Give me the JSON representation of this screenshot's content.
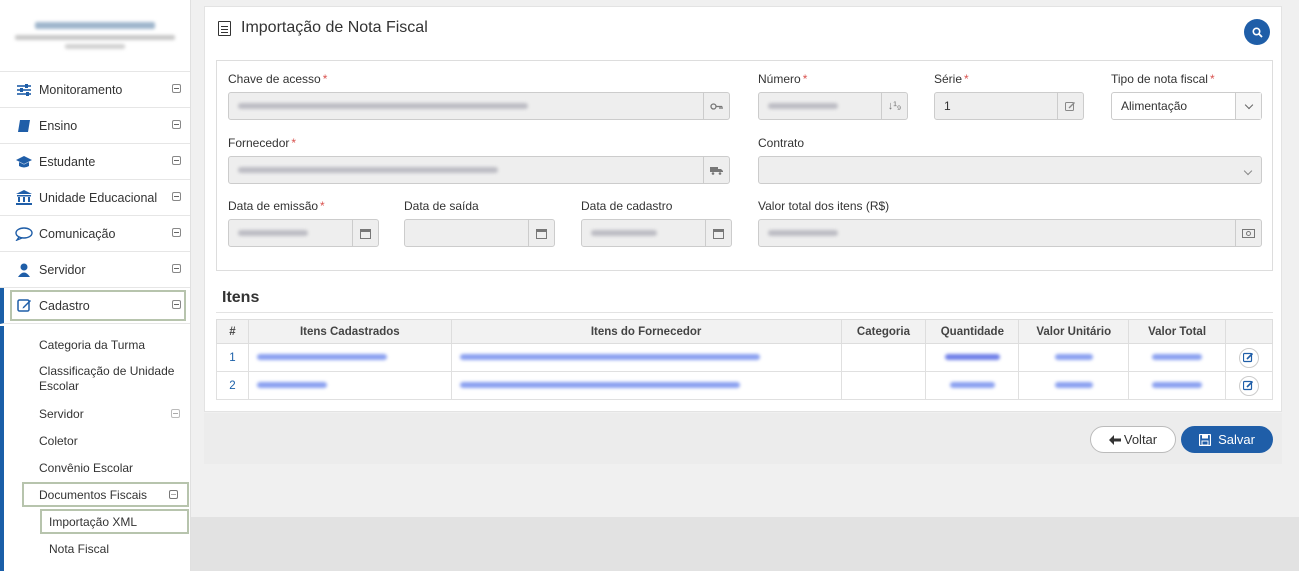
{
  "sidebar": {
    "menu": [
      {
        "label": "Monitoramento",
        "icon": "sliders-icon"
      },
      {
        "label": "Ensino",
        "icon": "book-icon"
      },
      {
        "label": "Estudante",
        "icon": "graduation-cap-icon"
      },
      {
        "label": "Unidade Educacional",
        "icon": "institution-icon"
      },
      {
        "label": "Comunicação",
        "icon": "chat-icon"
      },
      {
        "label": "Servidor",
        "icon": "user-icon"
      },
      {
        "label": "Cadastro",
        "icon": "edit-icon"
      }
    ],
    "submenu": {
      "categoria_turma": "Categoria da Turma",
      "classificacao_l1": "Classificação de Unidade",
      "classificacao_l2": "Escolar",
      "servidor": "Servidor",
      "coletor": "Coletor",
      "convenio": "Convênio Escolar",
      "documentos_fiscais": "Documentos Fiscais",
      "importacao_xml": "Importação XML",
      "nota_fiscal": "Nota Fiscal"
    }
  },
  "page": {
    "title": "Importação de Nota Fiscal"
  },
  "form": {
    "chave_label": "Chave de acesso",
    "numero_label": "Número",
    "serie_label": "Série",
    "serie_value": "1",
    "tipo_label": "Tipo de nota fiscal",
    "tipo_value": "Alimentação",
    "fornecedor_label": "Fornecedor",
    "contrato_label": "Contrato",
    "emissao_label": "Data de emissão",
    "saida_label": "Data de saída",
    "cadastro_label": "Data de cadastro",
    "valor_total_label": "Valor total dos itens (R$)",
    "required_mark": "*"
  },
  "items": {
    "title": "Itens",
    "headers": {
      "num": "#",
      "cadastrados": "Itens Cadastrados",
      "fornecedor": "Itens do Fornecedor",
      "categoria": "Categoria",
      "quantidade": "Quantidade",
      "valor_unitario": "Valor Unitário",
      "valor_total": "Valor Total"
    },
    "rows": [
      {
        "num": "1"
      },
      {
        "num": "2"
      }
    ]
  },
  "actions": {
    "voltar": "Voltar",
    "salvar": "Salvar"
  },
  "colors": {
    "primary": "#1f5ea8",
    "required": "#d9534f",
    "link": "#1a5fa8"
  }
}
